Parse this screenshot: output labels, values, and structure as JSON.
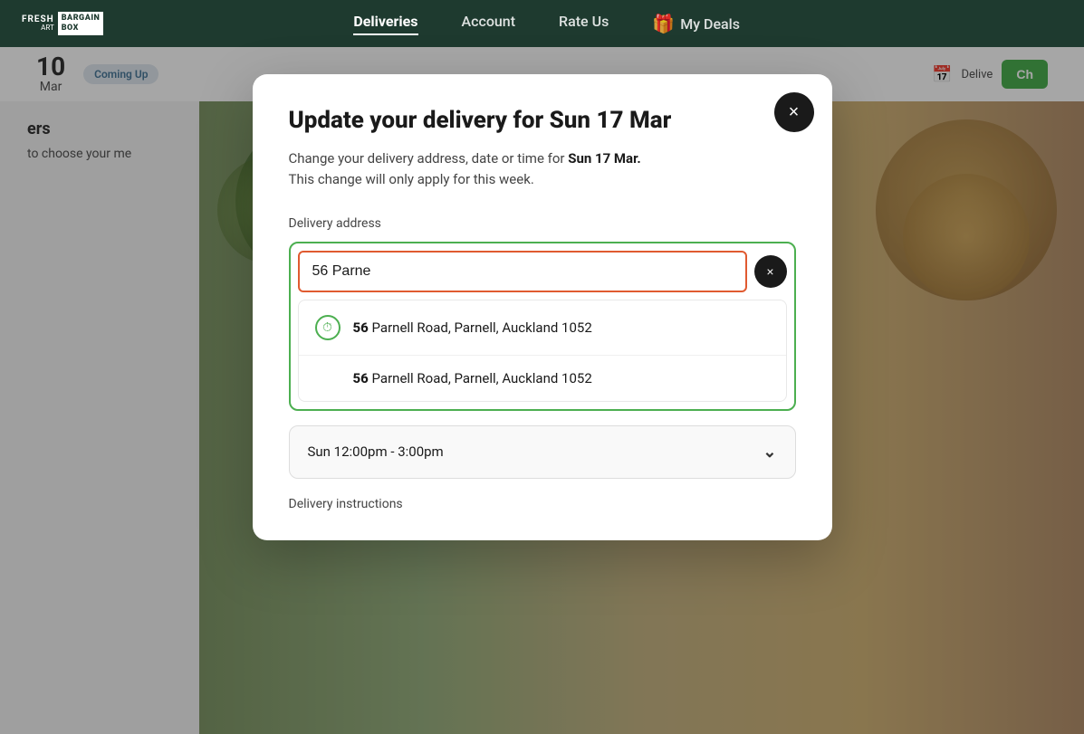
{
  "nav": {
    "logo": {
      "fresh": "Fresh",
      "art": "ART",
      "bargain": "BARGAIN\nBOX"
    },
    "links": [
      {
        "id": "deliveries",
        "label": "Deliveries",
        "active": true
      },
      {
        "id": "account",
        "label": "Account",
        "active": false
      },
      {
        "id": "rate-us",
        "label": "Rate Us",
        "active": false
      }
    ],
    "deals": {
      "icon": "🎁",
      "label": "My Deals"
    }
  },
  "background": {
    "date_number": "10",
    "date_month": "Mar",
    "coming_up_label": "Coming Up",
    "body_text": "to choose your me",
    "right_button": "Ch",
    "right_label": "Delive"
  },
  "modal": {
    "title": "Update your delivery for Sun 17 Mar",
    "description_prefix": "Change your delivery address, date or time for ",
    "description_bold": "Sun 17 Mar.",
    "description_suffix": "\nThis change will only apply for this week.",
    "address_label": "Delivery address",
    "address_value": "56 Parne",
    "suggestions": [
      {
        "bold": "56",
        "text": " Parnell Road, Parnell, Auckland 1052",
        "has_icon": true
      },
      {
        "bold": "56",
        "text": " Parnell Road, Parnell, Auckland 1052",
        "has_icon": false
      }
    ],
    "time_label": "Sun 12:00pm - 3:00pm",
    "delivery_instructions_label": "Delivery instructions",
    "close_button_label": "×"
  }
}
